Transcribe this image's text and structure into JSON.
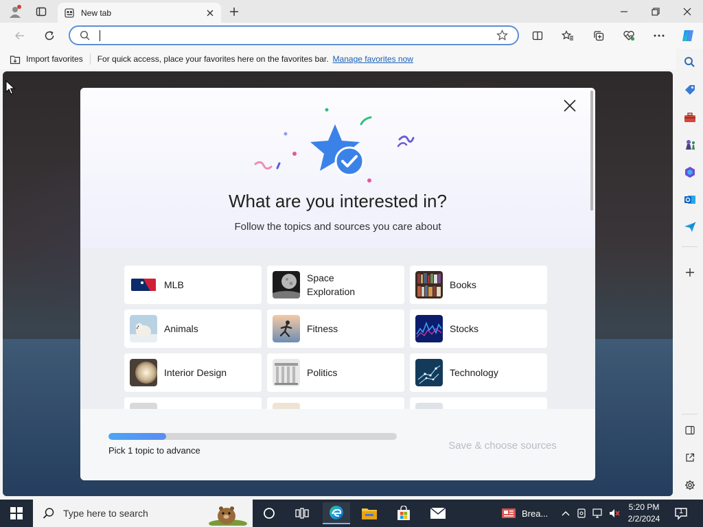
{
  "browser": {
    "tab_title": "New tab",
    "address_placeholder": "",
    "favorites_bar": {
      "import_label": "Import favorites",
      "message": "For quick access, place your favorites here on the favorites bar.",
      "manage_link": "Manage favorites now"
    }
  },
  "modal": {
    "title": "What are you interested in?",
    "subtitle": "Follow the topics and sources you care about",
    "topics": [
      {
        "label": "MLB",
        "icon": "mlb-logo"
      },
      {
        "label": "Space Exploration",
        "icon": "moon-photo"
      },
      {
        "label": "Books",
        "icon": "bookshelf-photo"
      },
      {
        "label": "Animals",
        "icon": "polar-bear-photo"
      },
      {
        "label": "Fitness",
        "icon": "runner-photo"
      },
      {
        "label": "Stocks",
        "icon": "stock-chart-photo"
      },
      {
        "label": "Interior Design",
        "icon": "lamp-photo"
      },
      {
        "label": "Politics",
        "icon": "columns-photo"
      },
      {
        "label": "Technology",
        "icon": "circuit-photo"
      }
    ],
    "progress_fraction": 0.2,
    "progress_label": "Pick 1 topic to advance",
    "save_button": "Save & choose sources"
  },
  "taskbar": {
    "search_placeholder": "Type here to search",
    "news_label": "Brea...",
    "time": "5:20 PM",
    "date": "2/2/2024",
    "notification_count": "1"
  },
  "colors": {
    "accent": "#5b8fd6",
    "link": "#1a5fb4",
    "taskbar": "#1f2937",
    "progress": "#4aa6f5",
    "disabled_text": "#b8bcc2"
  }
}
